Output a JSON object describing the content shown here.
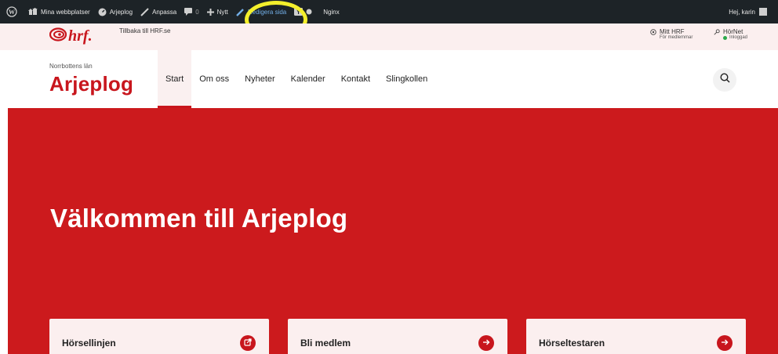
{
  "adminbar": {
    "my_sites": "Mina webbplatser",
    "site_name": "Arjeplog",
    "customize": "Anpassa",
    "comments_count": "0",
    "new": "Nytt",
    "edit_page": "Redigera sida",
    "nginx": "Nginx",
    "greeting": "Hej, karin"
  },
  "topstrip": {
    "logo": "hrf.",
    "back_link": "Tillbaka till HRF.se",
    "mitt_hrf": {
      "label": "Mitt HRF",
      "sub": "För medlemmar"
    },
    "hornet": {
      "label": "HörNet",
      "sub": "Inloggad"
    }
  },
  "header": {
    "region": "Norrbottens län",
    "site_title": "Arjeplog",
    "nav": [
      "Start",
      "Om oss",
      "Nyheter",
      "Kalender",
      "Kontakt",
      "Slingkollen"
    ]
  },
  "hero": {
    "title": "Välkommen till Arjeplog"
  },
  "cards": [
    "Hörsellinjen",
    "Bli medlem",
    "Hörseltestaren"
  ],
  "colors": {
    "brand_red": "#c8161d",
    "hero_red": "#cc1a1d",
    "pink_bg": "#fbefef",
    "admin_bar": "#1d2327",
    "highlight": "#f4ef2c"
  }
}
